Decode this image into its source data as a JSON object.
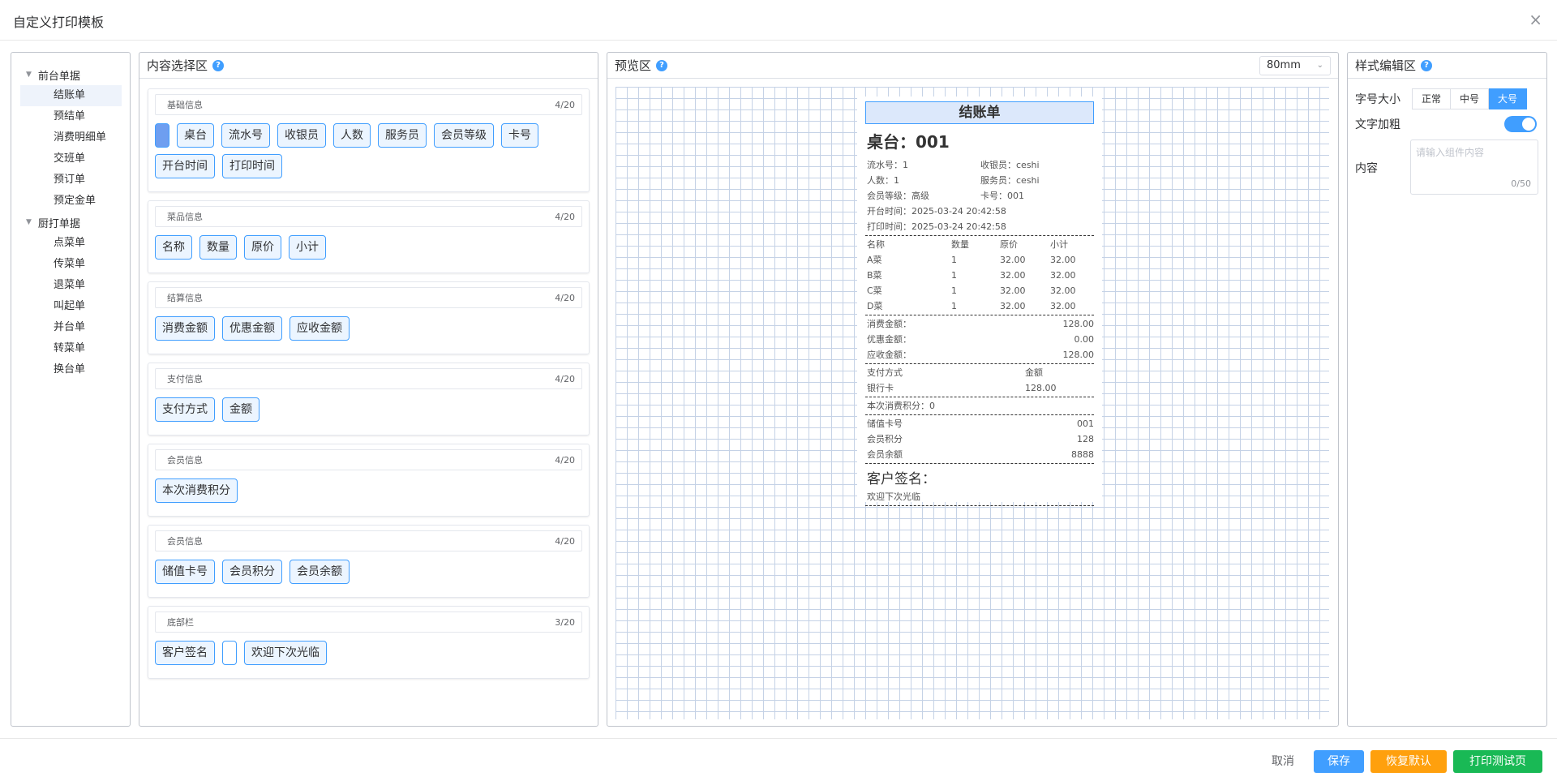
{
  "window": {
    "title": "自定义打印模板",
    "close": "×"
  },
  "tree": {
    "groups": [
      {
        "label": "前台单据",
        "items": [
          "结账单",
          "预结单",
          "消费明细单",
          "交班单",
          "预订单",
          "预定金单"
        ]
      },
      {
        "label": "厨打单据",
        "items": [
          "点菜单",
          "传菜单",
          "退菜单",
          "叫起单",
          "并台单",
          "转菜单",
          "换台单"
        ]
      }
    ],
    "selected": "结账单"
  },
  "content": {
    "title": "内容选择区",
    "sections": [
      {
        "name": "基础信息",
        "count": "4/20",
        "chips": [
          "",
          "桌台",
          "流水号",
          "收银员",
          "人数",
          "服务员",
          "会员等级",
          "卡号",
          "开台时间",
          "打印时间"
        ]
      },
      {
        "name": "菜品信息",
        "count": "4/20",
        "chips": [
          "名称",
          "数量",
          "原价",
          "小计"
        ]
      },
      {
        "name": "结算信息",
        "count": "4/20",
        "chips": [
          "消费金额",
          "优惠金额",
          "应收金额"
        ]
      },
      {
        "name": "支付信息",
        "count": "4/20",
        "chips": [
          "支付方式",
          "金额"
        ]
      },
      {
        "name": "会员信息",
        "count": "4/20",
        "chips": [
          "本次消费积分"
        ]
      },
      {
        "name": "会员信息",
        "count": "4/20",
        "chips": [
          "储值卡号",
          "会员积分",
          "会员余额"
        ]
      },
      {
        "name": "底部栏",
        "count": "3/20",
        "chips": [
          "客户签名",
          " ",
          "欢迎下次光临"
        ]
      }
    ]
  },
  "preview": {
    "title": "预览区",
    "paper_size": "80mm",
    "receipt": {
      "title": "结账单",
      "table": "桌台：001",
      "info": [
        [
          "流水号：1",
          "收银员：ceshi"
        ],
        [
          "人数：1",
          "服务员：ceshi"
        ],
        [
          "会员等级：高级",
          "卡号：001"
        ]
      ],
      "open_time": "开台时间：2025-03-24 20:42:58",
      "print_time": "打印时间：2025-03-24 20:42:58",
      "dish_headers": [
        "名称",
        "数量",
        "原价",
        "小计"
      ],
      "dishes": [
        [
          "A菜",
          "1",
          "32.00",
          "32.00"
        ],
        [
          "B菜",
          "1",
          "32.00",
          "32.00"
        ],
        [
          "C菜",
          "1",
          "32.00",
          "32.00"
        ],
        [
          "D菜",
          "1",
          "32.00",
          "32.00"
        ]
      ],
      "settle": [
        [
          "消费金额：",
          "128.00"
        ],
        [
          "优惠金额：",
          "0.00"
        ],
        [
          "应收金额：",
          "128.00"
        ]
      ],
      "pay_headers": [
        "支付方式",
        "金额"
      ],
      "pay_rows": [
        [
          "银行卡",
          "128.00"
        ]
      ],
      "points": "本次消费积分：0",
      "member": [
        [
          "储值卡号",
          "001"
        ],
        [
          "会员积分",
          "128"
        ],
        [
          "会员余额",
          "8888"
        ]
      ],
      "signature": "客户签名：",
      "welcome": "欢迎下次光临"
    }
  },
  "style_editor": {
    "title": "样式编辑区",
    "font_size_label": "字号大小",
    "font_sizes": [
      "正常",
      "中号",
      "大号"
    ],
    "font_size_selected": "大号",
    "bold_label": "文字加粗",
    "bold_on": true,
    "content_label": "内容",
    "content_placeholder": "请输入组件内容",
    "content_count": "0/50"
  },
  "footer": {
    "cancel": "取消",
    "save": "保存",
    "reset": "恢复默认",
    "test_print": "打印测试页"
  }
}
